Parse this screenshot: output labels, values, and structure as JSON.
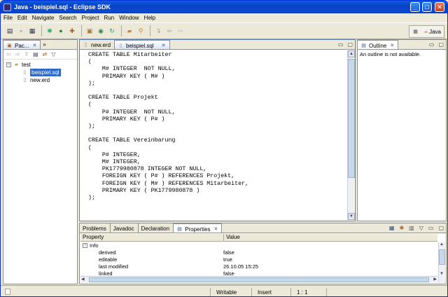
{
  "window": {
    "title": "Java - beispiel.sql - Eclipse SDK",
    "buttons": {
      "minimize": "_",
      "maximize": "□",
      "close": "✕"
    }
  },
  "menu": [
    "File",
    "Edit",
    "Navigate",
    "Search",
    "Project",
    "Run",
    "Window",
    "Help"
  ],
  "perspective": {
    "label": "Java"
  },
  "package_explorer": {
    "tab_label": "Pac...",
    "tree": {
      "project": "test",
      "files": [
        "beispiel.sql",
        "new.erd"
      ],
      "selected": "beispiel.sql"
    }
  },
  "editor": {
    "tabs": [
      {
        "label": "new.erd",
        "active": false
      },
      {
        "label": "beispiel.sql",
        "active": true
      }
    ],
    "content": "CREATE TABLE Mitarbeiter\n(\n    M# INTEGER  NOT NULL,\n    PRIMARY KEY ( M# )\n);\n\nCREATE TABLE Projekt\n(\n    P# INTEGER  NOT NULL,\n    PRIMARY KEY ( P# )\n);\n\nCREATE TABLE Vereinbarung\n(\n    P# INTEGER,\n    M# INTEGER,\n    PK1779980878 INTEGER NOT NULL,\n    FOREIGN KEY ( P# ) REFERENCES Projekt,\n    FOREIGN KEY ( M# ) REFERENCES Mitarbeiter,\n    PRIMARY KEY ( PK1779980878 )\n);"
  },
  "outline": {
    "tab_label": "Outline",
    "message": "An outline is not available."
  },
  "bottom_panel": {
    "tabs": [
      {
        "label": "Problems",
        "active": false
      },
      {
        "label": "Javadoc",
        "active": false
      },
      {
        "label": "Declaration",
        "active": false
      },
      {
        "label": "Properties",
        "active": true
      }
    ],
    "columns": [
      "Property",
      "Value"
    ],
    "category": "Info",
    "rows": [
      {
        "property": "derived",
        "value": "false"
      },
      {
        "property": "editable",
        "value": "true"
      },
      {
        "property": "last modified",
        "value": "26.10.05 15:25"
      },
      {
        "property": "linked",
        "value": "false"
      }
    ]
  },
  "status": {
    "writable": "Writable",
    "mode": "Insert",
    "position": "1 : 1"
  }
}
